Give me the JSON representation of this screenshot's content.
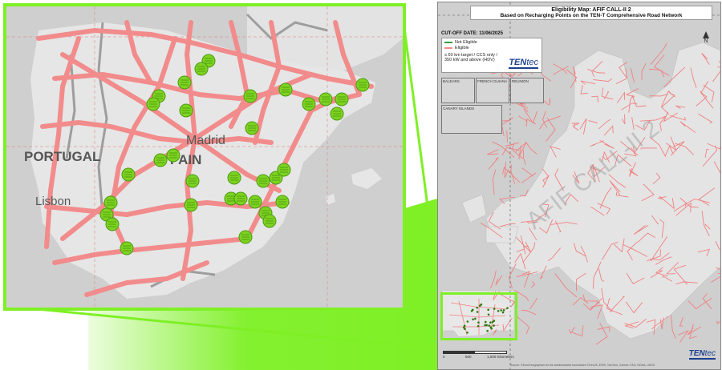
{
  "zoom_labels": {
    "portugal": "PORTUGAL",
    "madrid": "Madrid",
    "spain_fragment": "PAIN",
    "lisbon": "Lisbon"
  },
  "map": {
    "title_line1": "Eligibility Map: AFIF CALL-II 2",
    "title_line2": "Based on Recharging Points on the TEN-T Comprehensive Road Network",
    "cutoff": "CUT-OFF DATE: 11/06/2025",
    "watermark": "AFIF CALL-II 2",
    "north_label": "N",
    "brand": {
      "prefix": "TEN",
      "suffix": "tec"
    },
    "legend": {
      "items": [
        {
          "label": "Not Eligible",
          "color": "#2fa23a"
        },
        {
          "label": "Eligible",
          "color": "#f28b8b"
        }
      ],
      "note_line1": "≤ 60 km target / CCS only /",
      "note_line2": "350 kW and above (HDV)"
    },
    "insets": {
      "baleares": "BALEARS",
      "french_guiana": "FRENCH GUIANA",
      "reunion": "REUNION",
      "canary": "CANARY ISLANDS"
    },
    "scale": {
      "t0": "0",
      "t1": "500",
      "t2": "1,000 Kilometers"
    },
    "source": "Source: ©EuroGeographics for the administrative boundaries ©GeoJS, ESRI, TomTom, Garmin, FAO, NOAA, USGS"
  },
  "colors": {
    "road_eligible": "#f28b8b",
    "charging_point": "#7ed321",
    "highlight": "#7ef025",
    "land": "#e2e2e2",
    "sea": "#cfcfcf"
  }
}
